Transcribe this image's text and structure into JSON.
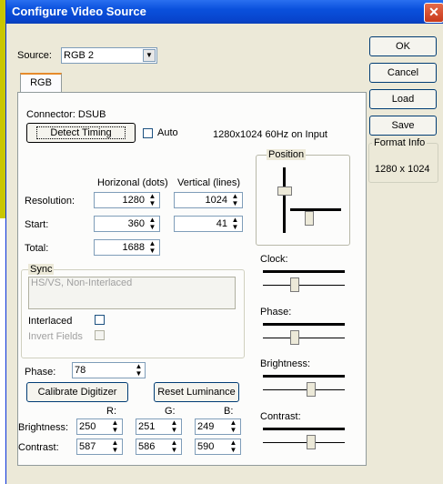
{
  "window": {
    "title": "Configure Video Source"
  },
  "source": {
    "label": "Source:",
    "value": "RGB 2"
  },
  "tabs": [
    {
      "label": "RGB"
    }
  ],
  "connector": {
    "label": "Connector: DSUB"
  },
  "detect_timing": {
    "label": "Detect Timing",
    "auto_label": "Auto"
  },
  "input_status": "1280x1024 60Hz on Input",
  "columns": {
    "horizontal": "Horizonal (dots)",
    "vertical": "Vertical (lines)"
  },
  "rows": {
    "resolution": {
      "label": "Resolution:",
      "h": "1280",
      "v": "1024"
    },
    "start": {
      "label": "Start:",
      "h": "360",
      "v": "41"
    },
    "total": {
      "label": "Total:",
      "h": "1688"
    }
  },
  "sync": {
    "legend": "Sync",
    "value": "HS/VS, Non-Interlaced",
    "interlaced_label": "Interlaced",
    "invert_label": "Invert Fields"
  },
  "phase_field": {
    "label": "Phase:",
    "value": "78"
  },
  "buttons": {
    "calibrate": "Calibrate Digitizer",
    "reset_luminance": "Reset Luminance"
  },
  "color": {
    "headers": [
      "R:",
      "G:",
      "B:"
    ],
    "brightness": {
      "label": "Brightness:",
      "values": [
        "250",
        "251",
        "249"
      ]
    },
    "contrast": {
      "label": "Contrast:",
      "values": [
        "587",
        "586",
        "590"
      ]
    }
  },
  "position": {
    "legend": "Position"
  },
  "sliders": {
    "clock": {
      "label": "Clock:",
      "level": 0.38
    },
    "phase": {
      "label": "Phase:",
      "level": 0.38
    },
    "brightness": {
      "label": "Brightness:",
      "level": 0.6
    },
    "contrast": {
      "label": "Contrast:",
      "level": 0.6
    }
  },
  "side_buttons": {
    "ok": "OK",
    "cancel": "Cancel",
    "load": "Load",
    "save": "Save"
  },
  "format_info": {
    "legend": "Format Info",
    "value": "1280 x 1024"
  }
}
